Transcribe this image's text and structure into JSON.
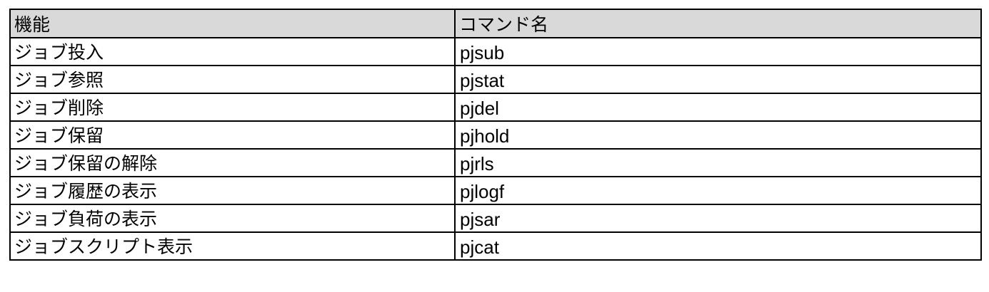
{
  "table": {
    "headers": {
      "function": "機能",
      "command": "コマンド名"
    },
    "rows": [
      {
        "function": "ジョブ投入",
        "command": "pjsub"
      },
      {
        "function": "ジョブ参照",
        "command": "pjstat"
      },
      {
        "function": "ジョブ削除",
        "command": "pjdel"
      },
      {
        "function": "ジョブ保留",
        "command": "pjhold"
      },
      {
        "function": "ジョブ保留の解除",
        "command": "pjrls"
      },
      {
        "function": "ジョブ履歴の表示",
        "command": "pjlogf"
      },
      {
        "function": "ジョブ負荷の表示",
        "command": "pjsar"
      },
      {
        "function": "ジョブスクリプト表示",
        "command": "pjcat"
      }
    ],
    "colors": {
      "header_background": "#d9d9d9",
      "border": "#000000",
      "text": "#000000"
    }
  }
}
